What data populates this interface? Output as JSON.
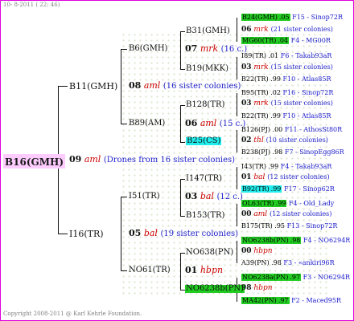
{
  "header": {
    "date": "10- 8-2011 ( 22: 46)"
  },
  "footer": {
    "copyright": "Copyright 2008-2011 @ Karl Kehrle Foundation."
  },
  "root": {
    "name": "B16(GMH)",
    "gen": "09",
    "queen": "aml",
    "note": "(Drones from 16 sister colonies)"
  },
  "g1": [
    {
      "name": "B11(GMH)",
      "gen": "08",
      "queen": "aml",
      "note": "(16 sister colonies)"
    },
    {
      "name": "I16(TR)",
      "gen": "05",
      "queen": "bal",
      "note": "(19 sister colonies)"
    }
  ],
  "g2": [
    {
      "name": "B6(GMH)",
      "gen": "07",
      "queen": "mrk",
      "note": "(16 c.)"
    },
    {
      "name": "B89(AM)",
      "gen": "06",
      "queen": "aml",
      "note": "(15 c.)"
    },
    {
      "name": "I51(TR)",
      "gen": "03",
      "queen": "bal",
      "note": "(12 c.)"
    },
    {
      "name": "NO61(TR)",
      "gen": "01",
      "queen": "hbpn",
      "note": ""
    }
  ],
  "g3": [
    {
      "name": "B31(GMH)",
      "gen": "06",
      "queen": "mrk",
      "note": "(21 sister colonies)"
    },
    {
      "name": "B19(MKK)",
      "gen": "03",
      "queen": "mrk",
      "note": "(15 sister colonies)"
    },
    {
      "name": "B128(TR)",
      "gen": "03",
      "queen": "mrk",
      "note": "(15 sister colonies)"
    },
    {
      "name": "B25(CS)",
      "gen": "02",
      "queen": "thl",
      "note": "(10 sister colonies)"
    },
    {
      "name": "I147(TR)",
      "gen": "01",
      "queen": "bal",
      "note": "(12 sister colonies)"
    },
    {
      "name": "B153(TR)",
      "gen": "00",
      "queen": "aml",
      "note": "(12 sister colonies)"
    },
    {
      "name": "NO638(PN)",
      "gen": "00",
      "queen": "hbpn",
      "note": ""
    },
    {
      "name": "NO6238b(PN)",
      "gen": "98",
      "queen": "hbpn",
      "note": ""
    }
  ],
  "g4": [
    {
      "name": "B24(GMH)",
      "year": ".05",
      "ref": "F15 - Sinop72R"
    },
    {
      "name": "MG60(TR)",
      "year": ".04",
      "ref": "F4 - MG00R"
    },
    {
      "name": "I89(TR)",
      "year": ".01",
      "ref": "F6 - Takab93aR"
    },
    {
      "name": "B22(TR)",
      "year": ".99",
      "ref": "F10 - Atlas85R"
    },
    {
      "name": "B95(TR)",
      "year": ".02",
      "ref": "F16 - Sinop72R"
    },
    {
      "name": "B22(TR)",
      "year": ".99",
      "ref": "F10 - Atlas85R"
    },
    {
      "name": "B126(PJ)",
      "year": ".00",
      "ref": "F11 - AthosSt80R"
    },
    {
      "name": "B238(PJ)",
      "year": ".98",
      "ref": "F7 - SinopEgg86R"
    },
    {
      "name": "I43(TR)",
      "year": ".99",
      "ref": "F4 - Takab93aR"
    },
    {
      "name": "B92(TR)",
      "year": ".99",
      "ref": "F17 - Sinop62R"
    },
    {
      "name": "OL63(TR)",
      "year": ".99",
      "ref": "F4 - Old_Lady"
    },
    {
      "name": "B175(TR)",
      "year": ".95",
      "ref": "F13 - Sinop72R"
    },
    {
      "name": "NO6238b(PN)",
      "year": ".98",
      "ref": "F4 - NO6294R"
    },
    {
      "name": "A39(PN)",
      "year": ".98",
      "ref": "F3 - «ankiri96R"
    },
    {
      "name": "NO6238a(PN)",
      "year": ".97",
      "ref": "F3 - NO6294R"
    },
    {
      "name": "MA42(PN)",
      "year": ".97",
      "ref": "F2 - Maced95R"
    }
  ],
  "g4_gen": [
    {
      "gen": "06",
      "queen": "mrk",
      "note": "(21 sister colonies)"
    },
    {
      "gen": "03",
      "queen": "mrk",
      "note": "(15 sister colonies)"
    },
    {
      "gen": "03",
      "queen": "mrk",
      "note": "(15 sister colonies)"
    },
    {
      "gen": "02",
      "queen": "thl",
      "note": "(10 sister colonies)"
    },
    {
      "gen": "01",
      "queen": "bal",
      "note": "(12 sister colonies)"
    },
    {
      "gen": "00",
      "queen": "aml",
      "note": "(12 sister colonies)"
    },
    {
      "gen": "00",
      "queen": "hbpn",
      "note": ""
    },
    {
      "gen": "98",
      "queen": "hbpn",
      "note": ""
    }
  ],
  "colors": {
    "frame": "#e000e0",
    "green": "#22cc22",
    "cyan": "#22eeee",
    "queen": "#cc0000",
    "note": "#2222cc"
  }
}
